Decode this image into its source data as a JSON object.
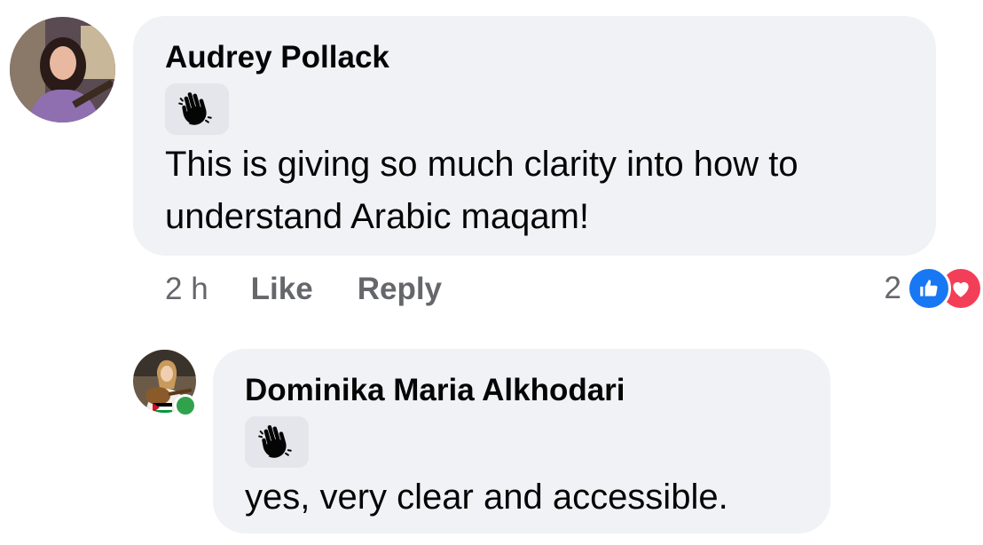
{
  "comments": [
    {
      "author": "Audrey Pollack",
      "reaction_icon": "waving-hand-icon",
      "text_line1": "This is giving so much clarity into how to",
      "text_line2": "understand Arabic maqam!",
      "time": "2 h",
      "like_label": "Like",
      "reply_label": "Reply",
      "reaction_count": "2",
      "reactions": [
        "like-icon",
        "love-icon"
      ]
    },
    {
      "author": "Dominika Maria Alkhodari",
      "reaction_icon": "waving-hand-icon",
      "text": "yes, very clear and accessible.",
      "online": true
    }
  ],
  "colors": {
    "bubble": "#f0f2f5",
    "meta_text": "#65676b",
    "like_blue": "#1877f2",
    "love_red": "#f33e58",
    "online_green": "#31a24c"
  }
}
